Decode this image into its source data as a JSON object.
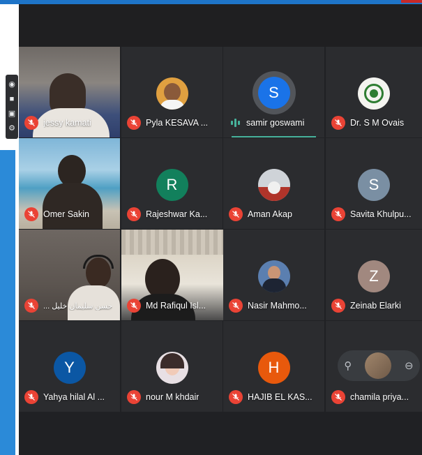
{
  "colors": {
    "stage_bg": "#202124",
    "tile_bg": "#3c4043",
    "muted_mic": "#ea4335",
    "speaking_accent": "#47b39c"
  },
  "toolbar": {
    "icons": [
      "camera-icon",
      "video-icon",
      "picture-icon",
      "settings-icon"
    ]
  },
  "participants": [
    {
      "name": "jessy kamati",
      "avatar_letter": "",
      "avatar_color": "",
      "muted": true
    },
    {
      "name": "Pyla KESAVA ...",
      "avatar_letter": "",
      "avatar_color": "",
      "muted": true
    },
    {
      "name": "samir goswami",
      "avatar_letter": "S",
      "avatar_color": "#1a73e8",
      "muted": false,
      "speaking": true
    },
    {
      "name": "Dr. S M Ovais",
      "avatar_letter": "",
      "avatar_color": "",
      "muted": true
    },
    {
      "name": "Omer Sakin",
      "avatar_letter": "",
      "avatar_color": "",
      "muted": true
    },
    {
      "name": "Rajeshwar Ka...",
      "avatar_letter": "R",
      "avatar_color": "#12805c",
      "muted": true
    },
    {
      "name": "Aman Akap",
      "avatar_letter": "",
      "avatar_color": "",
      "muted": true
    },
    {
      "name": "Savita Khulpu...",
      "avatar_letter": "S",
      "avatar_color": "#7a8fa3",
      "muted": true
    },
    {
      "name": "حسن سليمان خليل ...",
      "avatar_letter": "",
      "avatar_color": "",
      "muted": true
    },
    {
      "name": "Md Rafiqul Isl...",
      "avatar_letter": "",
      "avatar_color": "",
      "muted": true
    },
    {
      "name": "Nasir Mahmo...",
      "avatar_letter": "",
      "avatar_color": "",
      "muted": true
    },
    {
      "name": "Zeinab Elarki",
      "avatar_letter": "Z",
      "avatar_color": "#a1887f",
      "muted": true
    },
    {
      "name": "Yahya hilal Al ...",
      "avatar_letter": "Y",
      "avatar_color": "#0b57a4",
      "muted": true
    },
    {
      "name": "nour M khdair",
      "avatar_letter": "",
      "avatar_color": "",
      "muted": true
    },
    {
      "name": "HAJIB EL KAS...",
      "avatar_letter": "H",
      "avatar_color": "#e8590c",
      "muted": true
    },
    {
      "name": "chamila priya...",
      "avatar_letter": "",
      "avatar_color": "",
      "muted": true
    }
  ]
}
